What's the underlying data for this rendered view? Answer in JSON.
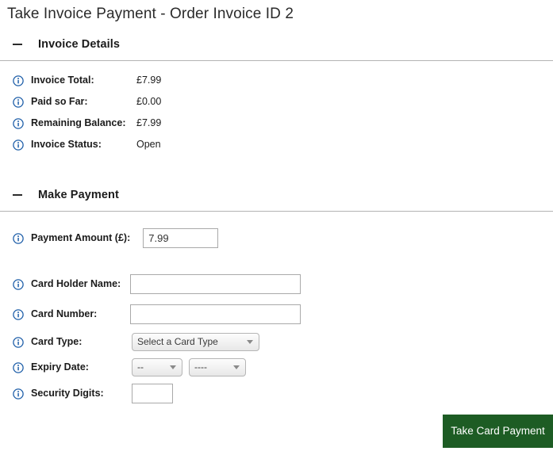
{
  "page": {
    "title": "Take Invoice Payment - Order Invoice ID 2"
  },
  "invoice_section": {
    "heading": "Invoice Details",
    "collapse_icon": "minus-icon",
    "rows": [
      {
        "label": "Invoice Total:",
        "value": "£7.99"
      },
      {
        "label": "Paid so Far:",
        "value": "£0.00"
      },
      {
        "label": "Remaining Balance:",
        "value": "£7.99"
      },
      {
        "label": "Invoice Status:",
        "value": "Open"
      }
    ]
  },
  "payment_section": {
    "heading": "Make Payment",
    "collapse_icon": "minus-icon",
    "fields": {
      "amount": {
        "label": "Payment Amount (£):",
        "value": "7.99",
        "placeholder": ""
      },
      "card_holder": {
        "label": "Card Holder Name:",
        "value": "",
        "placeholder": ""
      },
      "card_number": {
        "label": "Card Number:",
        "value": "",
        "placeholder": ""
      },
      "card_type": {
        "label": "Card Type:",
        "selected": "Select a Card Type",
        "options": [
          "Select a Card Type"
        ]
      },
      "expiry": {
        "label": "Expiry Date:",
        "month_selected": "--",
        "month_options": [
          "--"
        ],
        "year_selected": "----",
        "year_options": [
          "----"
        ]
      },
      "security": {
        "label": "Security Digits:",
        "value": "",
        "placeholder": ""
      }
    },
    "submit_label": "Take Card Payment"
  },
  "colors": {
    "button_green": "#1d5c24",
    "info_icon_blue": "#1f5fa9",
    "divider_gray": "#b3b3b3",
    "text": "#1b1b1b"
  }
}
